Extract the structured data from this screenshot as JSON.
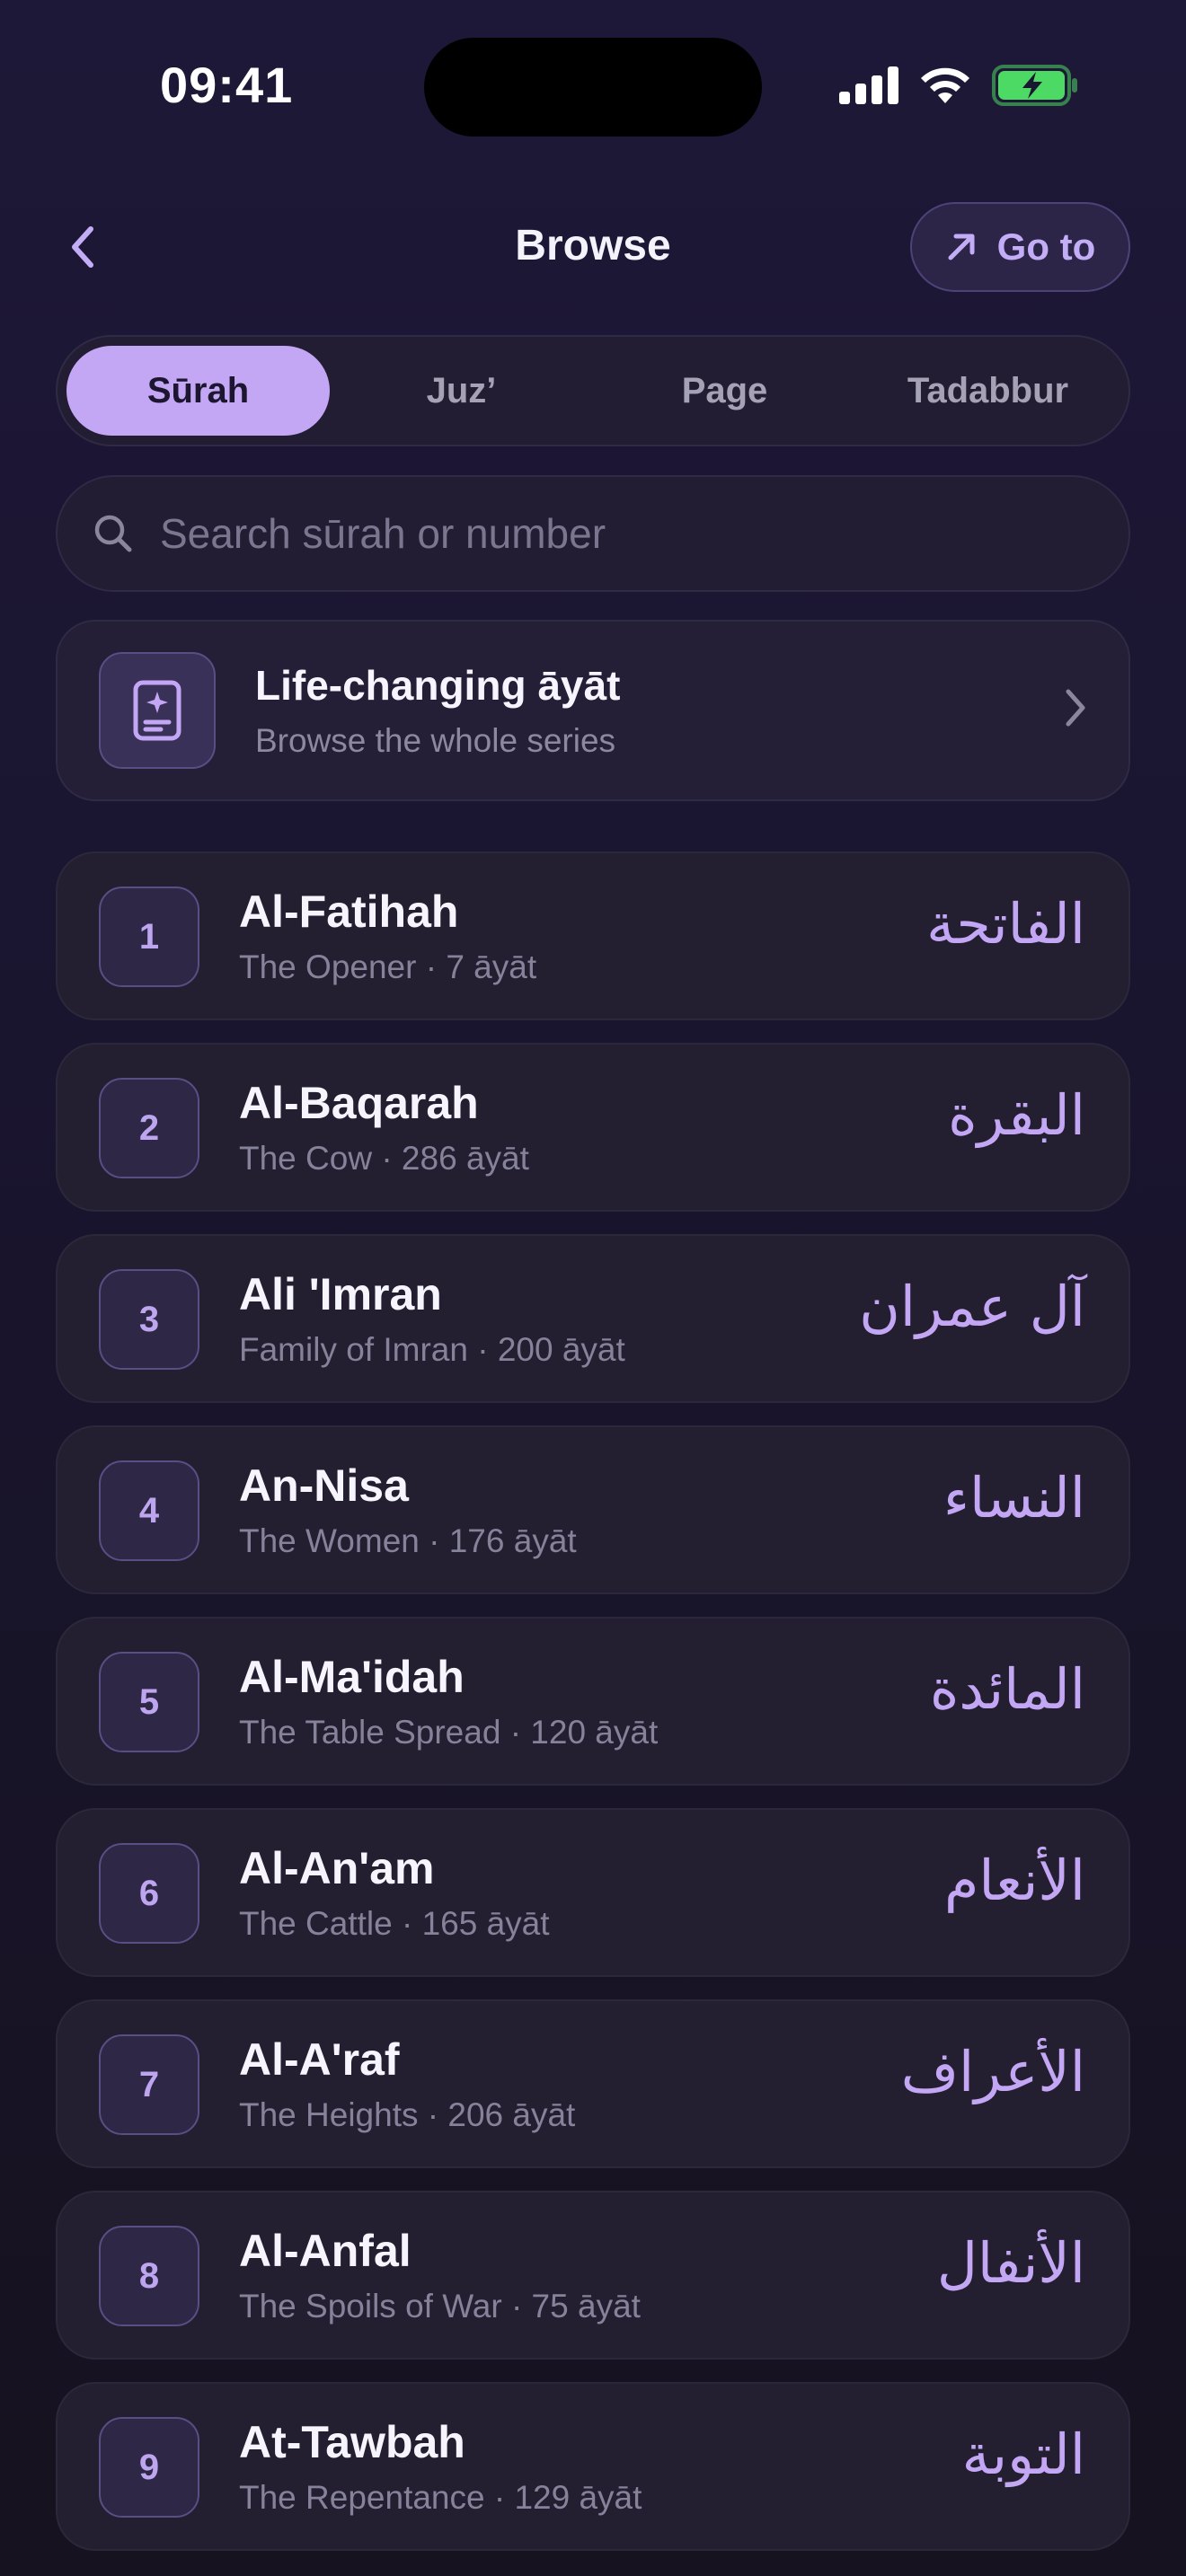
{
  "status": {
    "time": "09:41",
    "icons": [
      "cellular-signal-icon",
      "wifi-icon",
      "battery-charging-icon"
    ],
    "battery_color": "#4cd964"
  },
  "nav": {
    "title": "Browse",
    "back_icon": "chevron-left-icon",
    "goto_label": "Go to",
    "goto_icon": "arrow-up-right-icon"
  },
  "tabs": [
    {
      "label": "Sūrah",
      "active": true
    },
    {
      "label": "Juz’",
      "active": false
    },
    {
      "label": "Page",
      "active": false
    },
    {
      "label": "Tadabbur",
      "active": false
    }
  ],
  "search": {
    "placeholder": "Search sūrah or number",
    "value": "",
    "icon": "search-icon"
  },
  "banner": {
    "title": "Life-changing āyāt",
    "subtitle": "Browse the whole series",
    "icon": "book-sparkle-icon"
  },
  "surahs": [
    {
      "number": "1",
      "name": "Al-Fatihah",
      "meta": "The Opener · 7 āyāt",
      "arabic": "الفاتحة"
    },
    {
      "number": "2",
      "name": "Al-Baqarah",
      "meta": "The Cow · 286 āyāt",
      "arabic": "البقرة"
    },
    {
      "number": "3",
      "name": "Ali 'Imran",
      "meta": "Family of Imran · 200 āyāt",
      "arabic": "آل عمران"
    },
    {
      "number": "4",
      "name": "An-Nisa",
      "meta": "The Women · 176 āyāt",
      "arabic": "النساء"
    },
    {
      "number": "5",
      "name": "Al-Ma'idah",
      "meta": "The Table Spread · 120 āyāt",
      "arabic": "المائدة"
    },
    {
      "number": "6",
      "name": "Al-An'am",
      "meta": "The Cattle · 165 āyāt",
      "arabic": "الأنعام"
    },
    {
      "number": "7",
      "name": "Al-A'raf",
      "meta": "The Heights · 206 āyāt",
      "arabic": "الأعراف"
    },
    {
      "number": "8",
      "name": "Al-Anfal",
      "meta": "The Spoils of War · 75 āyāt",
      "arabic": "الأنفال"
    },
    {
      "number": "9",
      "name": "At-Tawbah",
      "meta": "The Repentance · 129 āyāt",
      "arabic": "التوبة"
    }
  ],
  "colors": {
    "accent": "#c3a7f4",
    "background": "#1c1733",
    "card": "#231f31"
  }
}
